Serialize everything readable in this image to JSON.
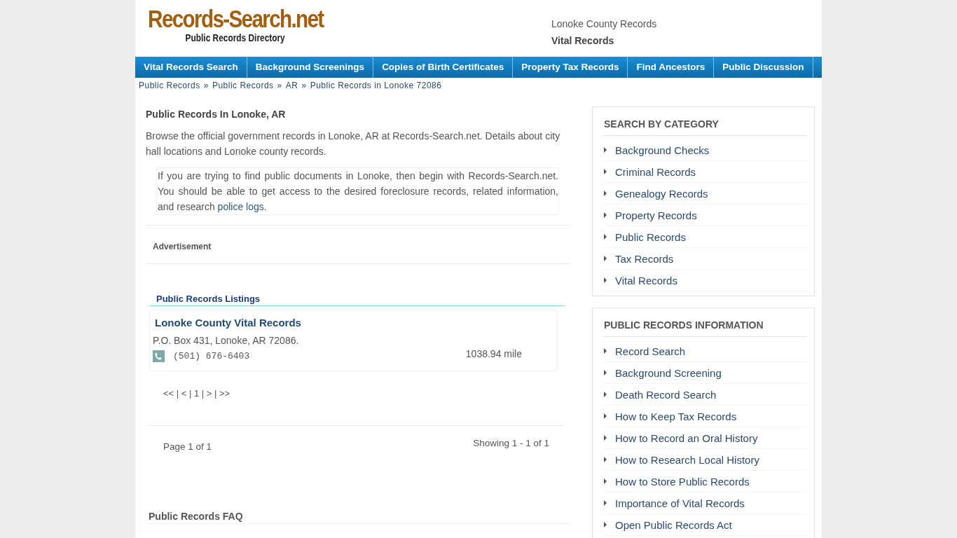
{
  "logo": {
    "name": "Records-Search.net",
    "tagline": "Public Records Directory"
  },
  "header": {
    "county": "Lonoke County Records",
    "section": "Vital Records"
  },
  "nav": [
    "Vital Records Search",
    "Background Screenings",
    "Copies of Birth Certificates",
    "Property Tax Records",
    "Find Ancestors",
    "Public Discussion"
  ],
  "breadcrumb": [
    "Public Records",
    "Public Records",
    "AR",
    "Public Records in Lonoke 72086"
  ],
  "breadcrumb_separator": "»",
  "main": {
    "title": "Public Records In Lonoke, AR",
    "intro": "Browse the official government records in Lonoke, AR at Records-Search.net. Details about city hall locations and Lonoke county records.",
    "note": "If you are trying to find public documents in Lonoke, then begin with Records-Search.net. You should be able to get access to the desired foreclosure records, related information, and research",
    "note_link": "police logs",
    "note_end": ".",
    "ad_label": "Advertisement",
    "listings_title": "Public Records Listings",
    "listings": [
      {
        "name": "Lonoke County Vital Records",
        "address": "P.O. Box 431, Lonoke, AR 72086.",
        "phone": "(501) 676-6403",
        "distance": "1038.94 mile"
      }
    ],
    "pager": "<< | < | 1 | > | >>",
    "page_info": "Page 1 of 1",
    "showing": "Showing 1 - 1 of 1",
    "faq_title": "Public Records FAQ"
  },
  "sidebar": [
    {
      "title": "SEARCH BY CATEGORY",
      "items": [
        "Background Checks",
        "Criminal Records",
        "Genealogy Records",
        "Property Records",
        "Public Records",
        "Tax Records",
        "Vital Records"
      ]
    },
    {
      "title": "PUBLIC RECORDS INFORMATION",
      "items": [
        "Record Search",
        "Background Screening",
        "Death Record Search",
        "How to Keep Tax Records",
        "How to Record an Oral History",
        "How to Research Local History",
        "How to Store Public Records",
        "Importance of Vital Records",
        "Open Public Records Act"
      ]
    }
  ]
}
